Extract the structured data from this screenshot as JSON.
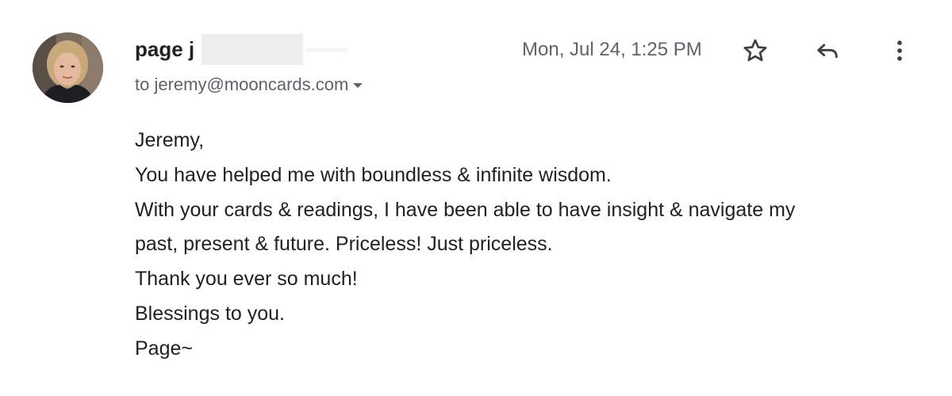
{
  "email": {
    "sender_name": "page j",
    "recipient": "to jeremy@mooncards.com",
    "date": "Mon, Jul 24, 1:25 PM",
    "body_lines": [
      "Jeremy,",
      "You have helped me with boundless & infinite wisdom.",
      "With your cards & readings, I have been able to have insight & navigate my",
      "past, present & future. Priceless! Just priceless.",
      "Thank you ever so much!",
      "Blessings to you.",
      "Page~"
    ]
  },
  "toolbar": {
    "star_icon": "star-icon",
    "reply_icon": "reply-icon",
    "more_icon": "more-vert-icon"
  },
  "colors": {
    "text_primary": "#202124",
    "text_secondary": "#5f6368",
    "redaction": "#ededee"
  }
}
